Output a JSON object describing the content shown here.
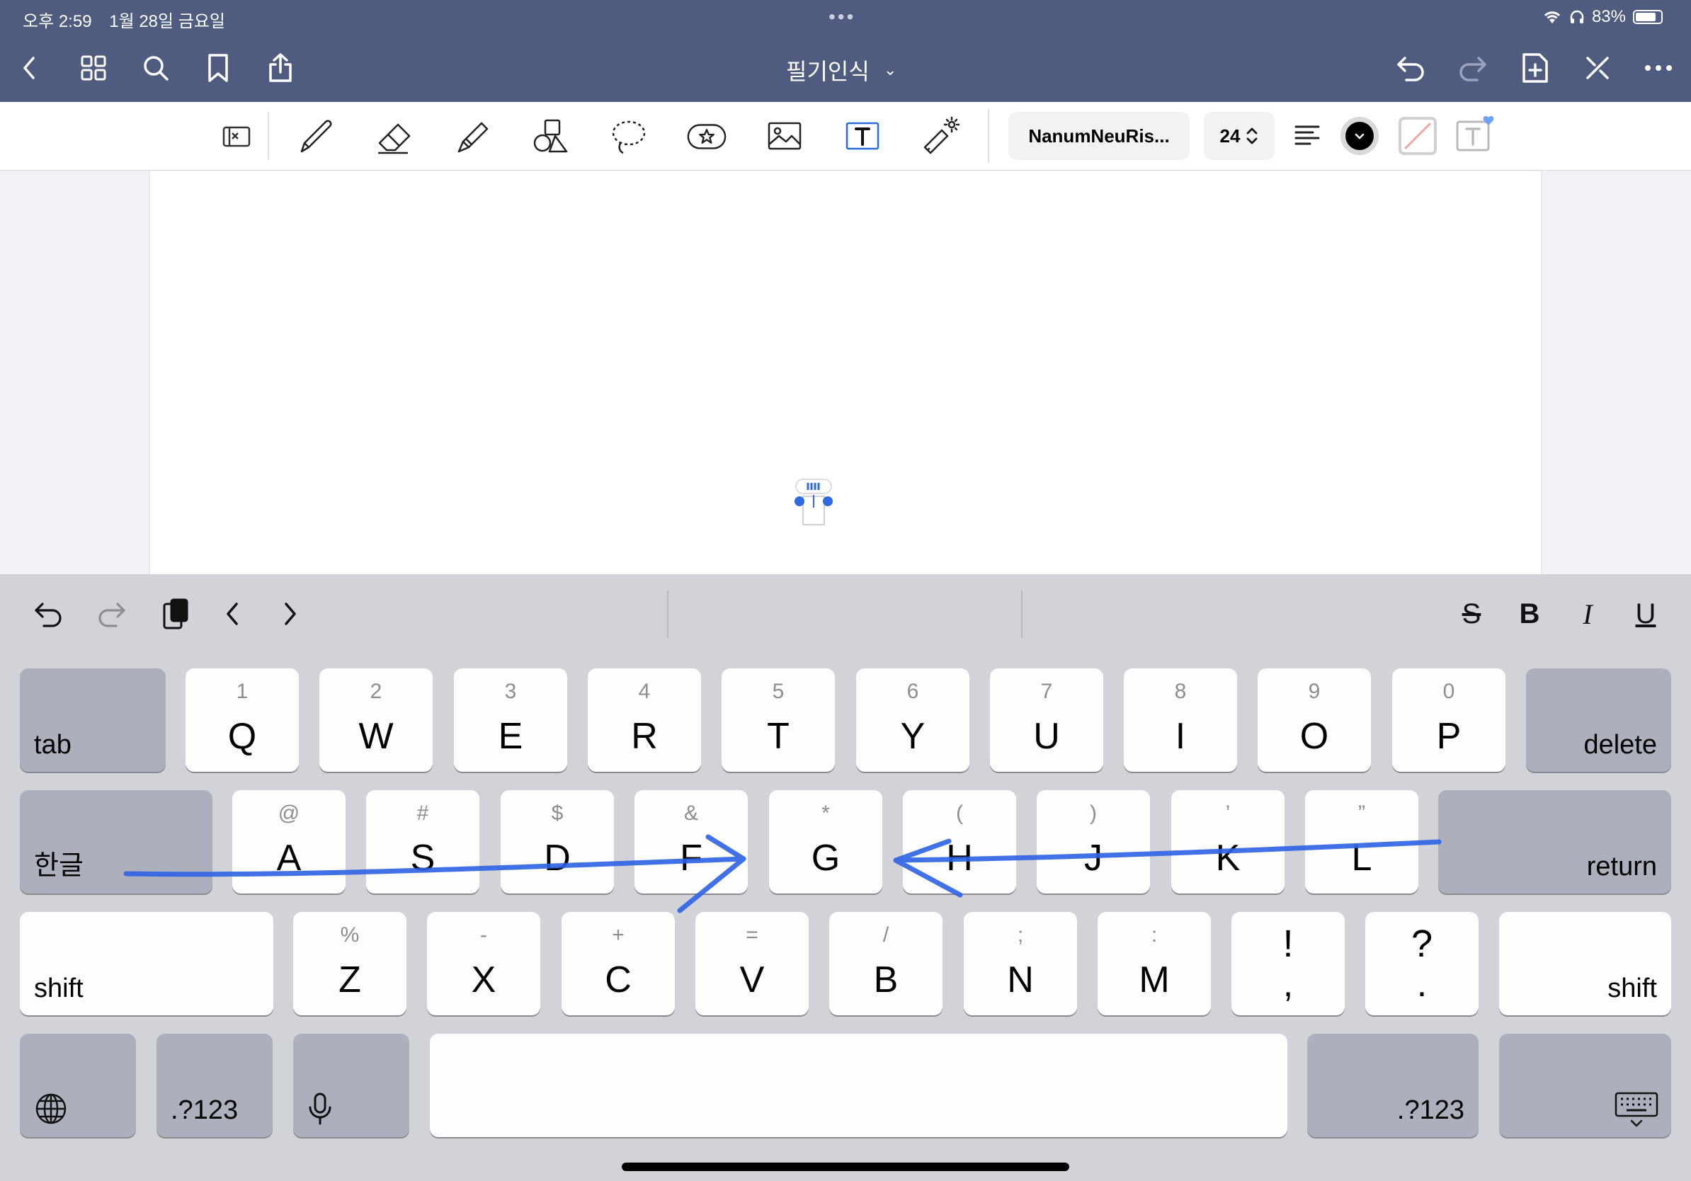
{
  "status": {
    "time": "오후 2:59",
    "date": "1월 28일 금요일",
    "battery": "83%",
    "battery_level": 0.83
  },
  "nav": {
    "title": "필기인식",
    "title_chevron": "⌄"
  },
  "toolbar": {
    "font_name": "NanumNeuRis...",
    "font_size": "24"
  },
  "keyboard": {
    "format": {
      "strike": "S",
      "bold": "B",
      "italic": "I",
      "underline": "U"
    },
    "row1": [
      {
        "main": "Q",
        "sec": "1"
      },
      {
        "main": "W",
        "sec": "2"
      },
      {
        "main": "E",
        "sec": "3"
      },
      {
        "main": "R",
        "sec": "4"
      },
      {
        "main": "T",
        "sec": "5"
      },
      {
        "main": "Y",
        "sec": "6"
      },
      {
        "main": "U",
        "sec": "7"
      },
      {
        "main": "I",
        "sec": "8"
      },
      {
        "main": "O",
        "sec": "9"
      },
      {
        "main": "P",
        "sec": "0"
      }
    ],
    "row2": [
      {
        "main": "A",
        "sec": "@"
      },
      {
        "main": "S",
        "sec": "#"
      },
      {
        "main": "D",
        "sec": "$"
      },
      {
        "main": "F",
        "sec": "&"
      },
      {
        "main": "G",
        "sec": "*"
      },
      {
        "main": "H",
        "sec": "("
      },
      {
        "main": "J",
        "sec": ")"
      },
      {
        "main": "K",
        "sec": "’"
      },
      {
        "main": "L",
        "sec": "”"
      }
    ],
    "row3": [
      {
        "main": "Z",
        "sec": "%"
      },
      {
        "main": "X",
        "sec": "-"
      },
      {
        "main": "C",
        "sec": "+"
      },
      {
        "main": "V",
        "sec": "="
      },
      {
        "main": "B",
        "sec": "/"
      },
      {
        "main": "N",
        "sec": ";"
      },
      {
        "main": "M",
        "sec": ":"
      },
      {
        "main": ",",
        "sec": "!"
      },
      {
        "main": ".",
        "sec": "?"
      }
    ],
    "tab": "tab",
    "delete": "delete",
    "hangul": "한글",
    "return": "return",
    "shift_left": "shift",
    "shift_right": "shift",
    "num_left": ".?123",
    "num_right": ".?123"
  }
}
